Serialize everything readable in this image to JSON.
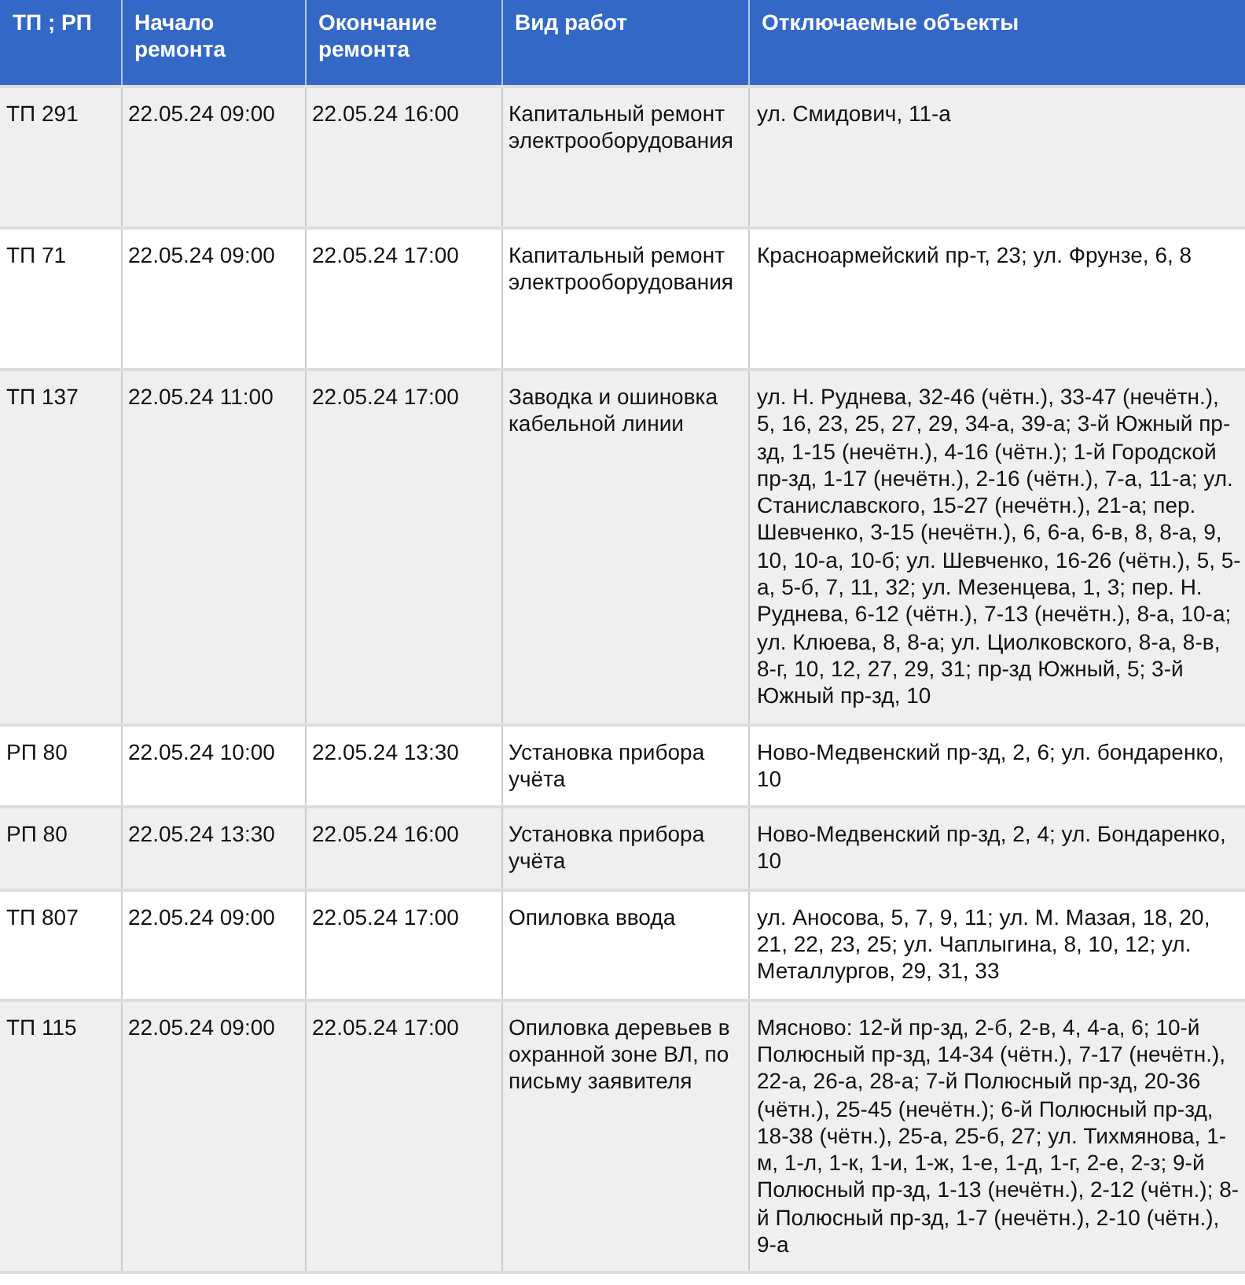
{
  "table": {
    "columns": [
      "ТП ; РП",
      "Начало ремонта",
      "Окончание ремонта",
      "Вид работ",
      "Отключаемые объекты"
    ],
    "rows": [
      {
        "substation": "ТП 291",
        "start": "22.05.24 09:00",
        "end": "22.05.24 16:00",
        "work_type": "Капитальный ремонт электрооборудования",
        "objects": "ул. Смидович, 11-а"
      },
      {
        "substation": "ТП 71",
        "start": "22.05.24 09:00",
        "end": "22.05.24 17:00",
        "work_type": "Капитальный ремонт электрооборудования",
        "objects": "Красноармейский пр-т, 23; ул. Фрунзе, 6, 8"
      },
      {
        "substation": "ТП 137",
        "start": "22.05.24 11:00",
        "end": "22.05.24 17:00",
        "work_type": "Заводка и ошиновка кабельной линии",
        "objects": "ул. Н. Руднева, 32-46 (чётн.), 33-47 (нечётн.), 5, 16, 23, 25, 27, 29, 34-а, 39-а; 3-й Южный пр-зд, 1-15 (нечётн.), 4-16 (чётн.); 1-й Городской пр-зд, 1-17 (нечётн.), 2-16 (чётн.), 7-а, 11-а; ул. Станиславского, 15-27 (нечётн.), 21-а; пер. Шевченко, 3-15 (нечётн.), 6, 6-а, 6-в, 8, 8-а, 9, 10, 10-а, 10-б; ул. Шевченко, 16-26 (чётн.), 5, 5-а, 5-б, 7, 11, 32; ул. Мезенцева, 1, 3; пер. Н. Руднева, 6-12 (чётн.), 7-13 (нечётн.), 8-а, 10-а; ул. Клюева, 8, 8-а; ул. Циолковского, 8-а, 8-в, 8-г, 10, 12, 27, 29, 31; пр-зд Южный, 5; 3-й Южный пр-зд, 10"
      },
      {
        "substation": "РП 80",
        "start": "22.05.24 10:00",
        "end": "22.05.24 13:30",
        "work_type": "Установка прибора учёта",
        "objects": "Ново-Медвенский пр-зд, 2, 6; ул. бондаренко, 10"
      },
      {
        "substation": "РП 80",
        "start": "22.05.24 13:30",
        "end": "22.05.24 16:00",
        "work_type": "Установка прибора учёта",
        "objects": "Ново-Медвенский пр-зд, 2, 4; ул. Бондаренко, 10"
      },
      {
        "substation": "ТП 807",
        "start": "22.05.24 09:00",
        "end": "22.05.24 17:00",
        "work_type": "Опиловка ввода",
        "objects": "ул. Аносова, 5, 7, 9, 11; ул. М. Мазая, 18, 20, 21, 22, 23, 25; ул. Чаплыгина, 8, 10, 12; ул. Металлургов, 29, 31, 33"
      },
      {
        "substation": "ТП 115",
        "start": "22.05.24 09:00",
        "end": "22.05.24 17:00",
        "work_type": "Опиловка деревьев в охранной зоне ВЛ, по письму заявителя",
        "objects": "Мясново: 12-й пр-зд, 2-б, 2-в, 4, 4-а, 6; 10-й Полюсный пр-зд, 14-34 (чётн.), 7-17 (нечётн.), 22-а, 26-а, 28-а; 7-й Полюсный пр-зд, 20-36 (чётн.), 25-45 (нечётн.); 6-й Полюсный пр-зд, 18-38 (чётн.), 25-а, 25-б, 27; ул. Тихмянова, 1-м, 1-л, 1-к, 1-и, 1-ж, 1-е, 1-д, 1-г, 2-е, 2-з; 9-й Полюсный пр-зд, 1-13 (нечётн.), 2-12 (чётн.); 8-й Полюсный пр-зд, 1-7 (нечётн.), 2-10 (чётн.), 9-а"
      }
    ]
  }
}
